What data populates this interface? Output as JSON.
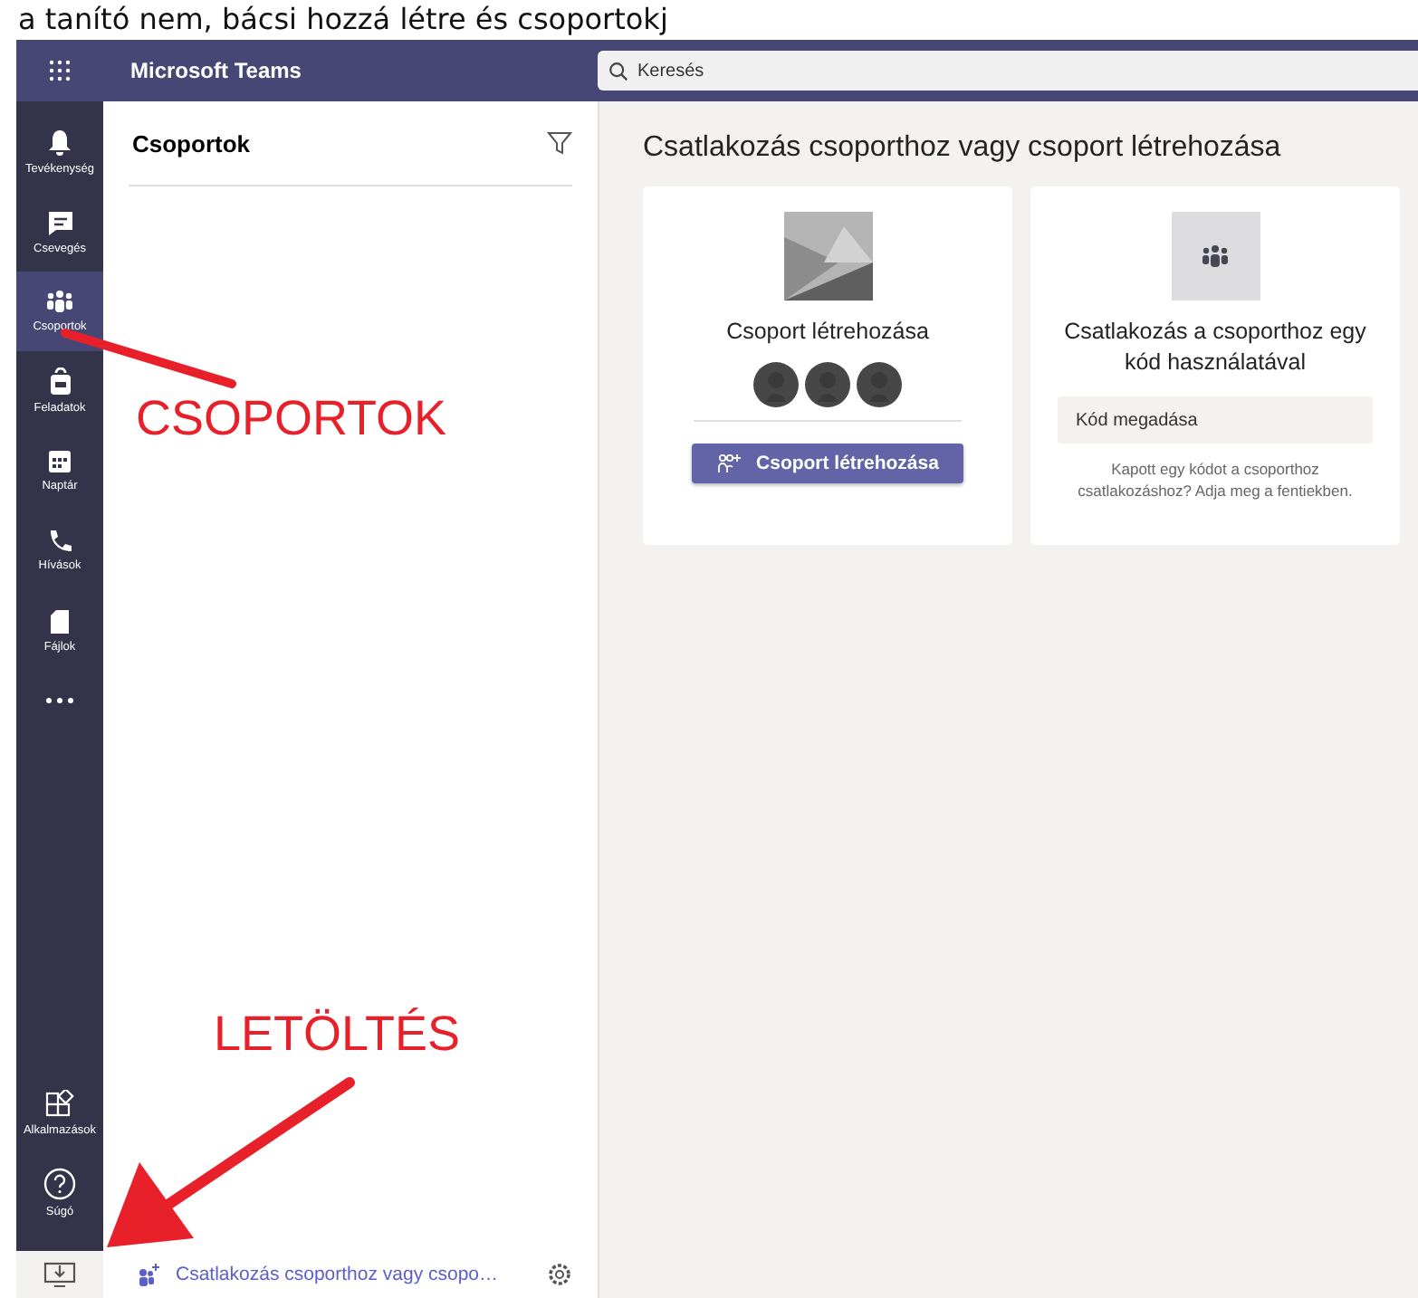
{
  "caption": "a tanító nem, bácsi hozzá létre és csoportokj",
  "app": {
    "title": "Microsoft Teams",
    "search": {
      "placeholder": "Keresés"
    }
  },
  "rail": {
    "items": [
      {
        "label": "Tevékenység",
        "kind": "bell",
        "selected": false
      },
      {
        "label": "Csevegés",
        "kind": "chat",
        "selected": false
      },
      {
        "label": "Csoportok",
        "kind": "teams",
        "selected": true
      },
      {
        "label": "Feladatok",
        "kind": "bag",
        "selected": false
      },
      {
        "label": "Naptár",
        "kind": "calendar",
        "selected": false
      },
      {
        "label": "Hívások",
        "kind": "phone",
        "selected": false
      },
      {
        "label": "Fájlok",
        "kind": "file",
        "selected": false
      }
    ],
    "bottom_items": [
      {
        "label": "Alkalmazások",
        "kind": "apps"
      },
      {
        "label": "Súgó",
        "kind": "help"
      }
    ]
  },
  "panel": {
    "title": "Csoportok",
    "footer_link": "Csatlakozás csoporthoz vagy csopo…"
  },
  "main": {
    "heading": "Csatlakozás csoporthoz vagy csoport létrehozása",
    "cards": [
      {
        "kind": "create",
        "title": "Csoport létrehozása",
        "button": "Csoport létrehozása"
      },
      {
        "kind": "join",
        "title": "Csatlakozás a csoporthoz egy kód használatával",
        "field": {
          "placeholder": "Kód megadása"
        },
        "hint": "Kapott egy kódot a csoporthoz csatlakozáshoz? Adja meg a fentiekben."
      }
    ]
  },
  "annotations": [
    {
      "text": "CSOPORTOK"
    },
    {
      "text": "LETÖLTÉS"
    }
  ]
}
